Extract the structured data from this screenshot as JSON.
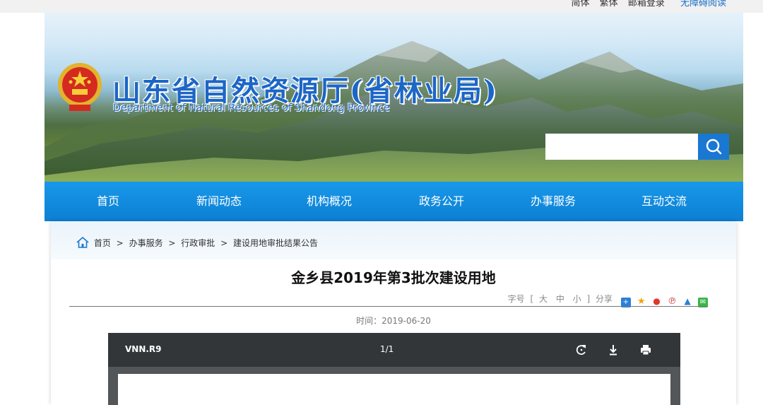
{
  "topbar": {
    "links": [
      "简体",
      "繁体",
      "邮箱登录"
    ],
    "accessibility": "无障碍阅读"
  },
  "header": {
    "title": "山东省自然资源厅(省林业局)",
    "subtitle": "Department of Natural Resources of Shandong Province",
    "search_placeholder": ""
  },
  "nav": {
    "items": [
      "首页",
      "新闻动态",
      "机构概况",
      "政务公开",
      "办事服务",
      "互动交流"
    ]
  },
  "breadcrumb": {
    "items": [
      "首页",
      "办事服务",
      "行政审批",
      "建设用地审批结果公告"
    ],
    "separator": ">"
  },
  "article": {
    "title": "金乡县2019年第3批次建设用地",
    "font_size_label": "字号",
    "bracket_open": "[",
    "bracket_close": "]",
    "sizes": [
      "大",
      "中",
      "小"
    ],
    "share_label": "分享",
    "date": "时间：2019-06-20"
  },
  "pdf_viewer": {
    "document_name": "VNN.R9",
    "page_indicator": "1/1",
    "icons": [
      "rotate-icon",
      "download-icon",
      "print-icon"
    ]
  },
  "colors": {
    "brand_blue": "#1c66c6",
    "nav_blue": "#0c7fd3",
    "viewer_toolbar": "#323639",
    "viewer_bg": "#525659"
  }
}
